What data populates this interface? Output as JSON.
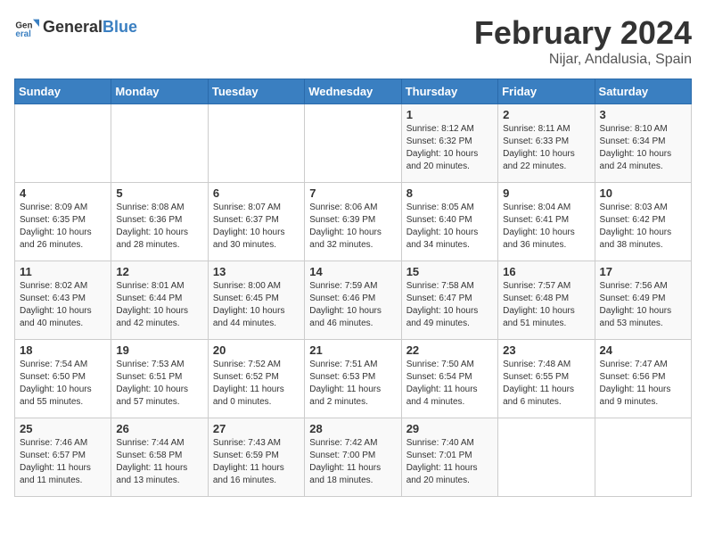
{
  "logo": {
    "general": "General",
    "blue": "Blue"
  },
  "header": {
    "month": "February 2024",
    "location": "Nijar, Andalusia, Spain"
  },
  "weekdays": [
    "Sunday",
    "Monday",
    "Tuesday",
    "Wednesday",
    "Thursday",
    "Friday",
    "Saturday"
  ],
  "weeks": [
    [
      {
        "day": "",
        "info": ""
      },
      {
        "day": "",
        "info": ""
      },
      {
        "day": "",
        "info": ""
      },
      {
        "day": "",
        "info": ""
      },
      {
        "day": "1",
        "info": "Sunrise: 8:12 AM\nSunset: 6:32 PM\nDaylight: 10 hours\nand 20 minutes."
      },
      {
        "day": "2",
        "info": "Sunrise: 8:11 AM\nSunset: 6:33 PM\nDaylight: 10 hours\nand 22 minutes."
      },
      {
        "day": "3",
        "info": "Sunrise: 8:10 AM\nSunset: 6:34 PM\nDaylight: 10 hours\nand 24 minutes."
      }
    ],
    [
      {
        "day": "4",
        "info": "Sunrise: 8:09 AM\nSunset: 6:35 PM\nDaylight: 10 hours\nand 26 minutes."
      },
      {
        "day": "5",
        "info": "Sunrise: 8:08 AM\nSunset: 6:36 PM\nDaylight: 10 hours\nand 28 minutes."
      },
      {
        "day": "6",
        "info": "Sunrise: 8:07 AM\nSunset: 6:37 PM\nDaylight: 10 hours\nand 30 minutes."
      },
      {
        "day": "7",
        "info": "Sunrise: 8:06 AM\nSunset: 6:39 PM\nDaylight: 10 hours\nand 32 minutes."
      },
      {
        "day": "8",
        "info": "Sunrise: 8:05 AM\nSunset: 6:40 PM\nDaylight: 10 hours\nand 34 minutes."
      },
      {
        "day": "9",
        "info": "Sunrise: 8:04 AM\nSunset: 6:41 PM\nDaylight: 10 hours\nand 36 minutes."
      },
      {
        "day": "10",
        "info": "Sunrise: 8:03 AM\nSunset: 6:42 PM\nDaylight: 10 hours\nand 38 minutes."
      }
    ],
    [
      {
        "day": "11",
        "info": "Sunrise: 8:02 AM\nSunset: 6:43 PM\nDaylight: 10 hours\nand 40 minutes."
      },
      {
        "day": "12",
        "info": "Sunrise: 8:01 AM\nSunset: 6:44 PM\nDaylight: 10 hours\nand 42 minutes."
      },
      {
        "day": "13",
        "info": "Sunrise: 8:00 AM\nSunset: 6:45 PM\nDaylight: 10 hours\nand 44 minutes."
      },
      {
        "day": "14",
        "info": "Sunrise: 7:59 AM\nSunset: 6:46 PM\nDaylight: 10 hours\nand 46 minutes."
      },
      {
        "day": "15",
        "info": "Sunrise: 7:58 AM\nSunset: 6:47 PM\nDaylight: 10 hours\nand 49 minutes."
      },
      {
        "day": "16",
        "info": "Sunrise: 7:57 AM\nSunset: 6:48 PM\nDaylight: 10 hours\nand 51 minutes."
      },
      {
        "day": "17",
        "info": "Sunrise: 7:56 AM\nSunset: 6:49 PM\nDaylight: 10 hours\nand 53 minutes."
      }
    ],
    [
      {
        "day": "18",
        "info": "Sunrise: 7:54 AM\nSunset: 6:50 PM\nDaylight: 10 hours\nand 55 minutes."
      },
      {
        "day": "19",
        "info": "Sunrise: 7:53 AM\nSunset: 6:51 PM\nDaylight: 10 hours\nand 57 minutes."
      },
      {
        "day": "20",
        "info": "Sunrise: 7:52 AM\nSunset: 6:52 PM\nDaylight: 11 hours\nand 0 minutes."
      },
      {
        "day": "21",
        "info": "Sunrise: 7:51 AM\nSunset: 6:53 PM\nDaylight: 11 hours\nand 2 minutes."
      },
      {
        "day": "22",
        "info": "Sunrise: 7:50 AM\nSunset: 6:54 PM\nDaylight: 11 hours\nand 4 minutes."
      },
      {
        "day": "23",
        "info": "Sunrise: 7:48 AM\nSunset: 6:55 PM\nDaylight: 11 hours\nand 6 minutes."
      },
      {
        "day": "24",
        "info": "Sunrise: 7:47 AM\nSunset: 6:56 PM\nDaylight: 11 hours\nand 9 minutes."
      }
    ],
    [
      {
        "day": "25",
        "info": "Sunrise: 7:46 AM\nSunset: 6:57 PM\nDaylight: 11 hours\nand 11 minutes."
      },
      {
        "day": "26",
        "info": "Sunrise: 7:44 AM\nSunset: 6:58 PM\nDaylight: 11 hours\nand 13 minutes."
      },
      {
        "day": "27",
        "info": "Sunrise: 7:43 AM\nSunset: 6:59 PM\nDaylight: 11 hours\nand 16 minutes."
      },
      {
        "day": "28",
        "info": "Sunrise: 7:42 AM\nSunset: 7:00 PM\nDaylight: 11 hours\nand 18 minutes."
      },
      {
        "day": "29",
        "info": "Sunrise: 7:40 AM\nSunset: 7:01 PM\nDaylight: 11 hours\nand 20 minutes."
      },
      {
        "day": "",
        "info": ""
      },
      {
        "day": "",
        "info": ""
      }
    ]
  ]
}
